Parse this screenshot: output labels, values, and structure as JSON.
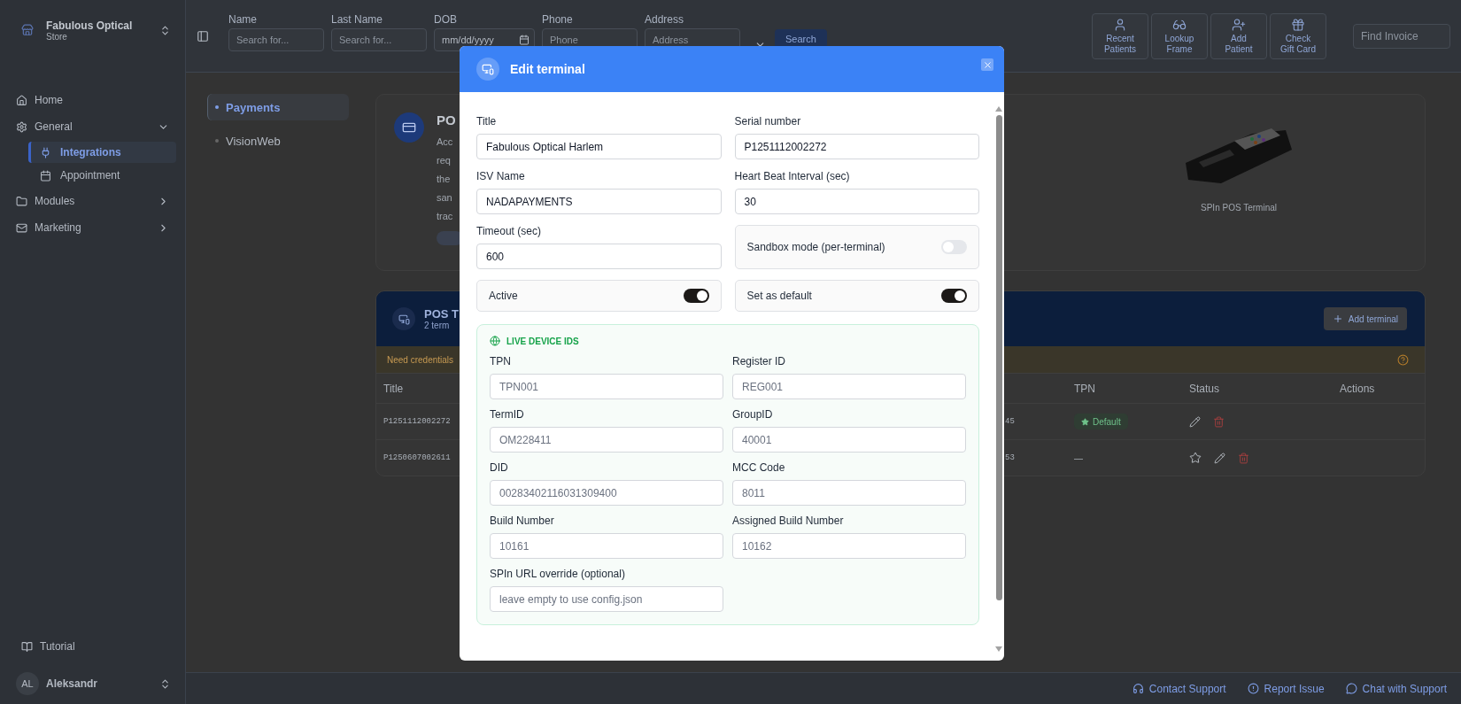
{
  "sidebar": {
    "store_name": "Fabulous Optical",
    "store_subtitle": "Store",
    "items": [
      {
        "label": "Home",
        "kind": "link"
      },
      {
        "label": "General",
        "kind": "group",
        "expanded": true,
        "children": [
          {
            "label": "Integrations",
            "selected": true
          },
          {
            "label": "Appointment",
            "selected": false
          }
        ]
      },
      {
        "label": "Modules",
        "kind": "group",
        "expanded": false
      },
      {
        "label": "Marketing",
        "kind": "group",
        "expanded": false
      }
    ],
    "tutorial": "Tutorial",
    "user": {
      "initials": "AL",
      "name": "Aleksandr"
    }
  },
  "topbar": {
    "search_fields": [
      {
        "label": "Name",
        "placeholder": "Search for...",
        "kind": "text"
      },
      {
        "label": "Last Name",
        "placeholder": "Search for...",
        "kind": "text"
      },
      {
        "label": "DOB",
        "placeholder": "mm/dd/yyyy",
        "kind": "date"
      },
      {
        "label": "Phone",
        "placeholder": "Phone",
        "kind": "text"
      },
      {
        "label": "Address",
        "placeholder": "Address",
        "kind": "text"
      }
    ],
    "search_button": "Search",
    "quick_actions": [
      "Recent Patients",
      "Lookup Frame",
      "Add Patient",
      "Check Gift Card"
    ],
    "find_invoice": {
      "placeholder": "Find Invoice"
    }
  },
  "subnav": [
    {
      "label": "Payments",
      "selected": true
    },
    {
      "label": "VisionWeb",
      "selected": false
    }
  ],
  "pos_card": {
    "title": "PO",
    "description_lines": [
      "Acc",
      "req",
      "the",
      "san",
      "trac"
    ],
    "image_caption": "SPIn POS Terminal"
  },
  "terminals": {
    "title": "POS T",
    "subtitle": "2 term",
    "add_button": "Add terminal",
    "notice": "Need credentials",
    "columns": [
      "Title",
      "TPN",
      "Status",
      "Actions"
    ],
    "rows": [
      {
        "title": "P1251112002272",
        "column_2": "45",
        "tpn": "Default",
        "default": true
      },
      {
        "title": "P1250607002611",
        "column_2": "53",
        "tpn": "—",
        "default": false
      }
    ]
  },
  "footer_links": [
    "Contact Support",
    "Report Issue",
    "Chat with Support"
  ],
  "modal": {
    "title": "Edit terminal",
    "fields": [
      {
        "label": "Title",
        "value": "Fabulous Optical Harlem",
        "kind": "input"
      },
      {
        "label": "Serial number",
        "value": "P1251112002272",
        "kind": "input"
      },
      {
        "label": "ISV Name",
        "value": "NADAPAYMENTS",
        "kind": "input"
      },
      {
        "label": "Heart Beat Interval (sec)",
        "value": "30",
        "kind": "input"
      },
      {
        "label": "Timeout (sec)",
        "value": "600",
        "kind": "input"
      },
      {
        "label": "Sandbox mode (per-terminal)",
        "on": false,
        "kind": "toggle"
      },
      {
        "label": "Active",
        "on": true,
        "kind": "toggle"
      },
      {
        "label": "Set as default",
        "on": true,
        "kind": "toggle"
      }
    ],
    "live_section": {
      "title": "LIVE DEVICE IDS",
      "fields": [
        {
          "label": "TPN",
          "placeholder": "TPN001"
        },
        {
          "label": "Register ID",
          "placeholder": "REG001"
        },
        {
          "label": "TermID",
          "placeholder": "OM228411"
        },
        {
          "label": "GroupID",
          "placeholder": "40001"
        },
        {
          "label": "DID",
          "placeholder": "00283402116031309400"
        },
        {
          "label": "MCC Code",
          "placeholder": "8011"
        },
        {
          "label": "Build Number",
          "placeholder": "10161"
        },
        {
          "label": "Assigned Build Number",
          "placeholder": "10162"
        },
        {
          "label": "SPIn URL override (optional)",
          "placeholder": "leave empty to use config.json"
        }
      ]
    }
  }
}
